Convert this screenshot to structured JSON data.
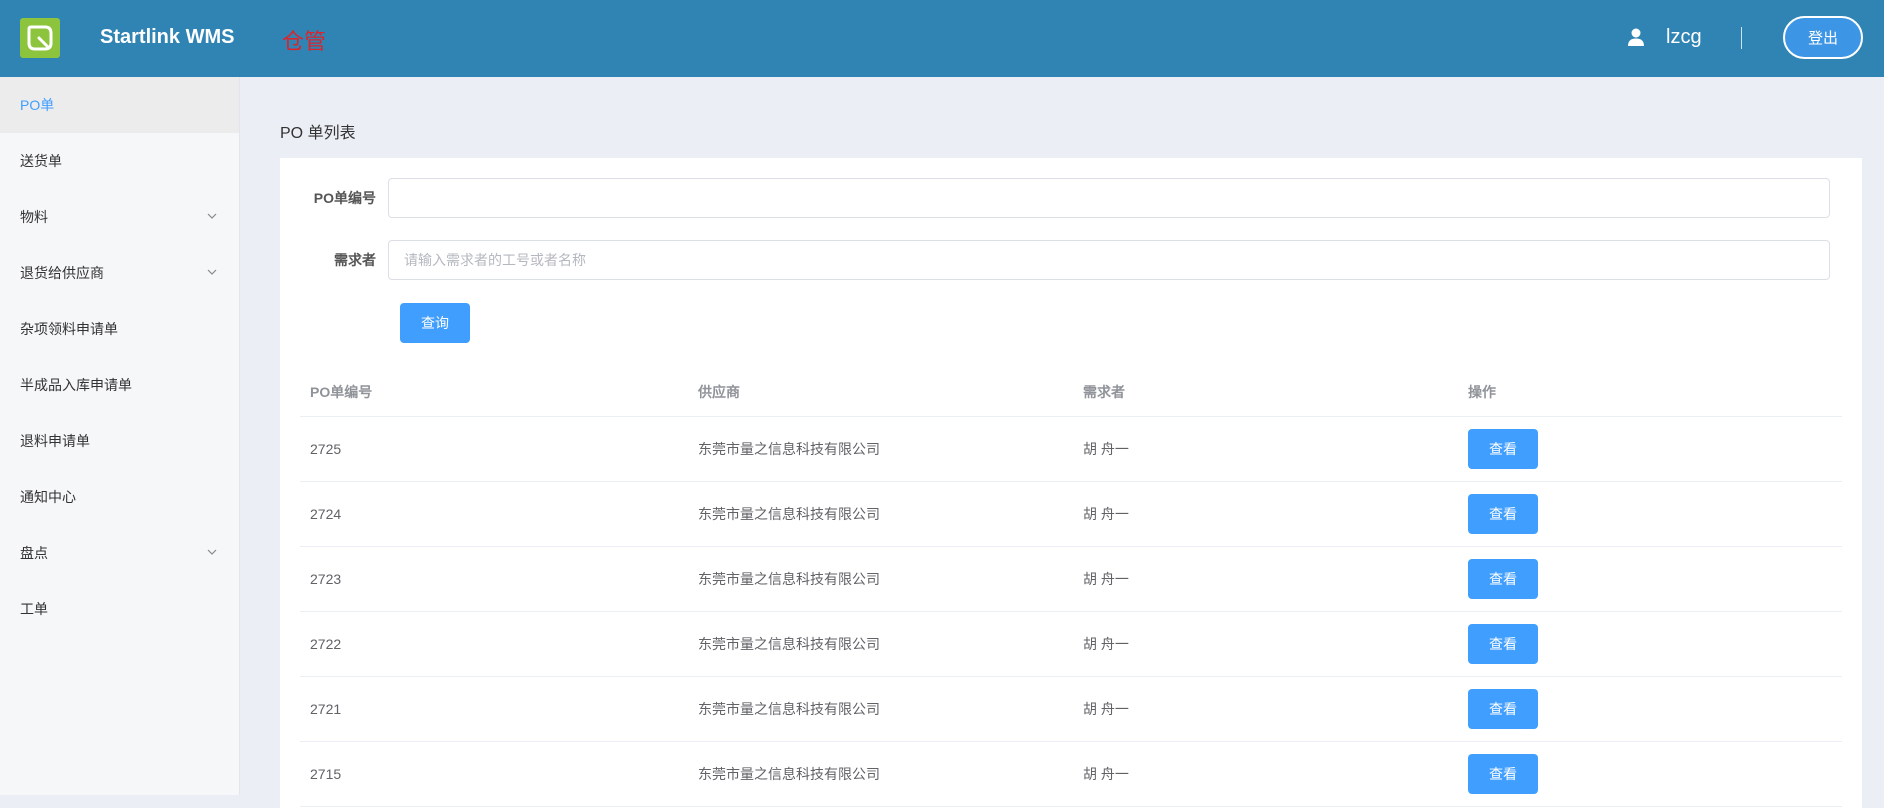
{
  "header": {
    "app_title": "Startlink WMS",
    "role_label": "仓管",
    "username": "lzcg",
    "logout_label": "登出",
    "brand_color": "#2f84b4",
    "logo_color": "#8cc43d"
  },
  "sidebar": {
    "items": [
      {
        "label": "PO单",
        "active": true,
        "has_submenu": false
      },
      {
        "label": "送货单",
        "active": false,
        "has_submenu": false
      },
      {
        "label": "物料",
        "active": false,
        "has_submenu": true
      },
      {
        "label": "退货给供应商",
        "active": false,
        "has_submenu": true
      },
      {
        "label": "杂项领料申请单",
        "active": false,
        "has_submenu": false
      },
      {
        "label": "半成品入库申请单",
        "active": false,
        "has_submenu": false
      },
      {
        "label": "退料申请单",
        "active": false,
        "has_submenu": false
      },
      {
        "label": "通知中心",
        "active": false,
        "has_submenu": false
      },
      {
        "label": "盘点",
        "active": false,
        "has_submenu": true
      },
      {
        "label": "工单",
        "active": false,
        "has_submenu": false
      }
    ]
  },
  "main": {
    "page_heading": "PO 单列表",
    "form": {
      "po_label": "PO单编号",
      "po_value": "",
      "requester_label": "需求者",
      "requester_placeholder": "请输入需求者的工号或者名称",
      "query_label": "查询"
    },
    "table": {
      "columns": [
        "PO单编号",
        "供应商",
        "需求者",
        "操作"
      ],
      "view_label": "查看",
      "rows": [
        {
          "po": "2725",
          "supplier": "东莞市量之信息科技有限公司",
          "requester": "胡 舟一"
        },
        {
          "po": "2724",
          "supplier": "东莞市量之信息科技有限公司",
          "requester": "胡 舟一"
        },
        {
          "po": "2723",
          "supplier": "东莞市量之信息科技有限公司",
          "requester": "胡 舟一"
        },
        {
          "po": "2722",
          "supplier": "东莞市量之信息科技有限公司",
          "requester": "胡 舟一"
        },
        {
          "po": "2721",
          "supplier": "东莞市量之信息科技有限公司",
          "requester": "胡 舟一"
        },
        {
          "po": "2715",
          "supplier": "东莞市量之信息科技有限公司",
          "requester": "胡 舟一"
        }
      ]
    }
  }
}
